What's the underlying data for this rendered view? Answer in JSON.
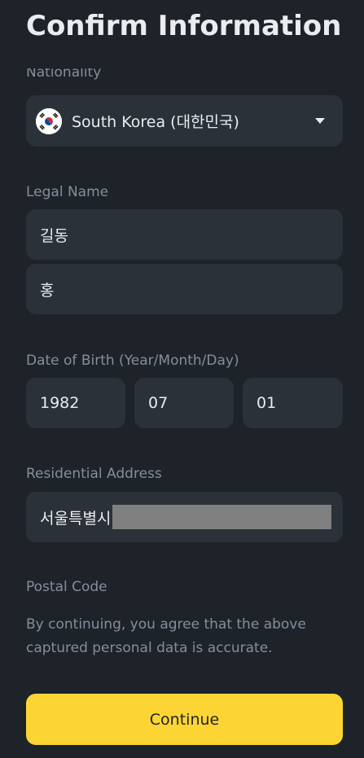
{
  "header": {
    "title": "Confirm Information"
  },
  "nationality": {
    "label": "Nationality",
    "value": "South Korea (대한민국)",
    "flag_icon": "south-korea-flag-icon",
    "caret_icon": "caret-down-icon"
  },
  "legal_name": {
    "label": "Legal Name",
    "first_name": "길동",
    "last_name": "홍"
  },
  "date_of_birth": {
    "label": "Date of Birth (Year/Month/Day)",
    "year": "1982",
    "month": "07",
    "day": "01"
  },
  "residential_address": {
    "label": "Residential Address",
    "value": "서울특별시"
  },
  "postal_code": {
    "label": "Postal Code"
  },
  "disclaimer": "By continuing, you agree that the above captured personal data is accurate.",
  "actions": {
    "continue_label": "Continue"
  },
  "colors": {
    "background": "#1e2329",
    "field": "#2b3139",
    "label": "#848e9c",
    "text": "#eaecef",
    "accent": "#fcd535",
    "redaction": "#808080"
  }
}
